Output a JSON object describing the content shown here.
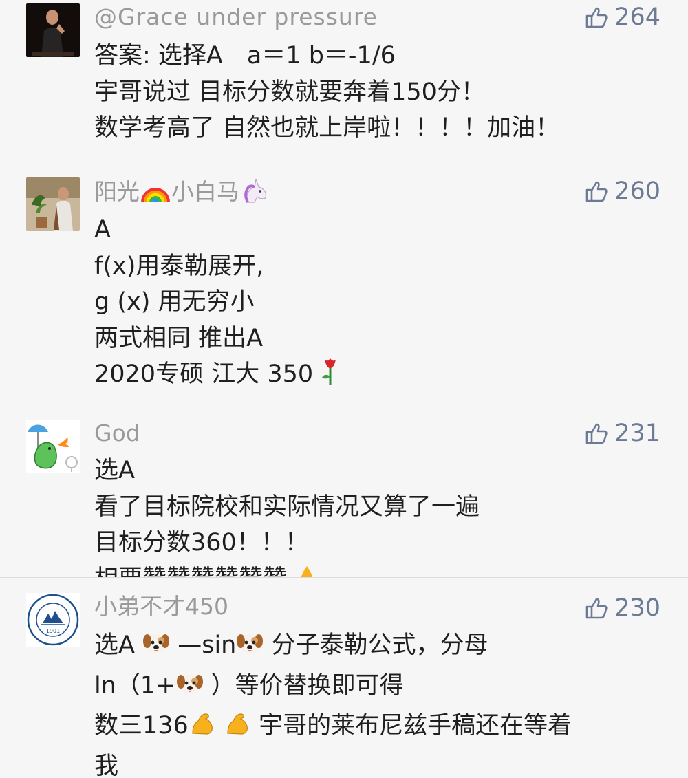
{
  "comments": [
    {
      "name": "@Grace under pressure",
      "likes": "264",
      "lines": [
        "答案: 选择A　a＝1 b＝-1/6",
        "宇哥说过 目标分数就要奔着150分！",
        "数学考高了 自然也就上岸啦！！！！加油！"
      ]
    },
    {
      "name": "阳光",
      "name_suffix": "小白马",
      "likes": "260",
      "lines": [
        "A",
        "f(x)用泰勒展开,",
        "g (x) 用无穷小",
        "两式相同 推出A",
        "2020专硕 江大 350"
      ]
    },
    {
      "name": "God",
      "likes": "231",
      "lines": [
        "选A",
        "看了目标院校和实际情况又算了一遍",
        "目标分数360！！！",
        "相要赞赞赞赞赞赞"
      ]
    },
    {
      "name": "小弟不才450",
      "likes": "230",
      "avatar_text": "1901",
      "lines": {
        "l1a": "选A ",
        "l1b": " —sin",
        "l1c": " 分子泰勒公式，分母",
        "l2a": "ln（1+",
        "l2b": " ）等价替换即可得",
        "l3a": "数三136",
        "l3b": " 宇哥的莱布尼兹手稿还在等着",
        "l4": "我"
      }
    }
  ],
  "icons": {
    "like": "thumbs-up-icon",
    "rainbow": "rainbow-emoji",
    "unicorn": "unicorn-emoji",
    "rose": "rose-emoji",
    "dog": "dog-face-emoji",
    "muscle": "flexed-biceps-emoji",
    "pray": "folded-hands-emoji"
  },
  "colors": {
    "background": "#f6f6f6",
    "name": "#9a9a9a",
    "like": "#6d7a96",
    "text": "#1f1f1f"
  }
}
